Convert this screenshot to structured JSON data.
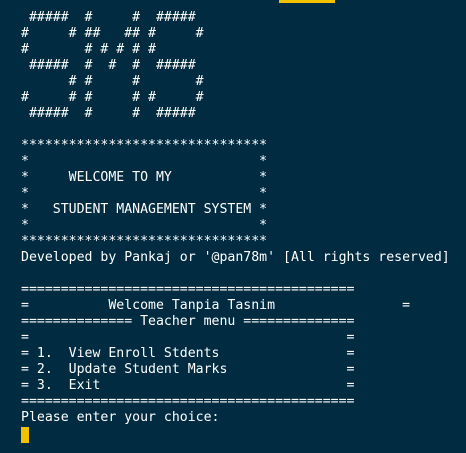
{
  "colors": {
    "background": "#002b40",
    "text": "#ffffff",
    "cursor": "#f2c200",
    "top_accent": "#f2c200"
  },
  "terminal": {
    "banner_art": [
      " #####  #     #  #####",
      "#     # ##   ## #     #",
      "#       # # # # #",
      " #####  #  #  #  #####",
      "      # #     #       #",
      "#     # #     # #     #",
      " #####  #     #  #####"
    ],
    "welcome_box": [
      "*******************************",
      "*                             *",
      "*     WELCOME TO MY           *",
      "*                             *",
      "*   STUDENT MANAGEMENT SYSTEM *",
      "*                             *",
      "*******************************"
    ],
    "developer_line": "Developed by Pankaj or '@pan78m' [All rights reserved]",
    "menu_top_border": "==========================================",
    "menu_welcome": "=          Welcome Tanpia Tasnim                =",
    "menu_title_line": "============== Teacher menu ==============",
    "menu_spacer": "=                                        =",
    "menu_option_1": "= 1.  View Enroll Stdents                =",
    "menu_option_2": "= 2.  Update Student Marks               =",
    "menu_option_3": "= 3.  Exit                               =",
    "menu_bottom_border": "==========================================",
    "prompt": "Please enter your choice:"
  }
}
